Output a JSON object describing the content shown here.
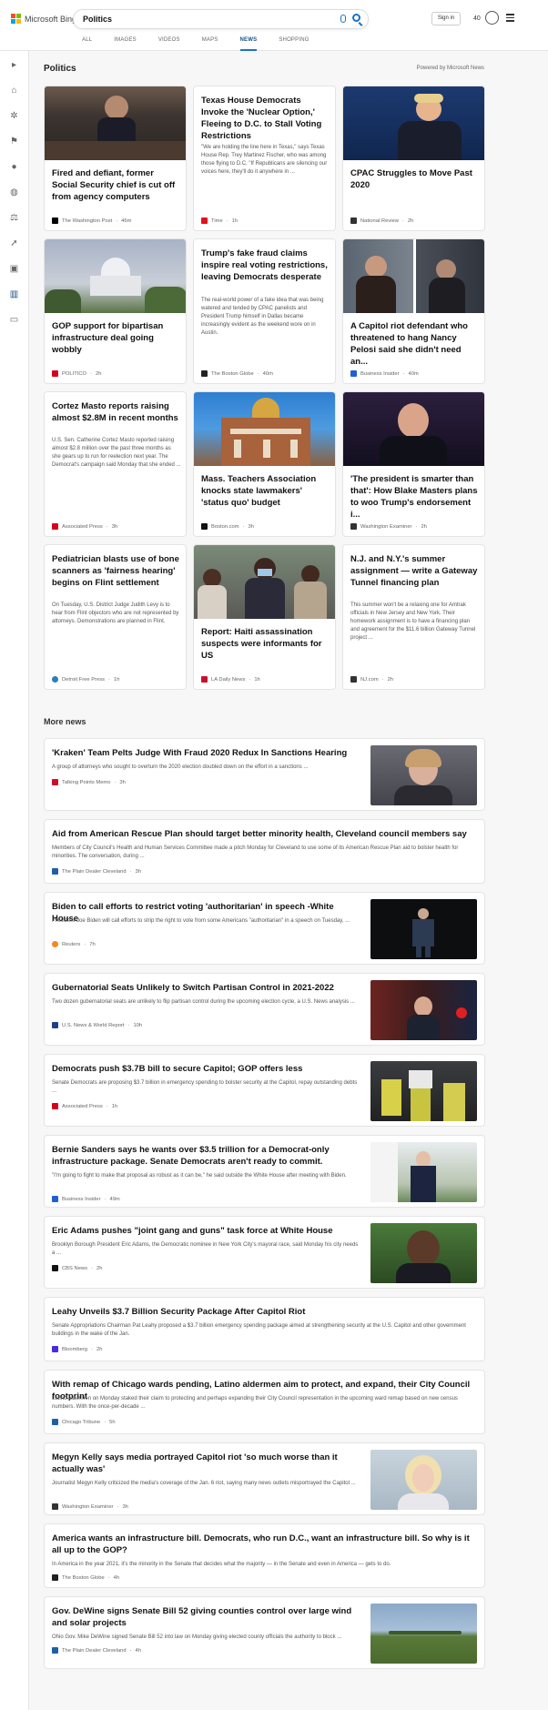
{
  "header": {
    "logo_text": "Microsoft Bing",
    "search_query": "Politics",
    "tabs": [
      "ALL",
      "IMAGES",
      "VIDEOS",
      "MAPS",
      "NEWS",
      "SHOPPING"
    ],
    "active_tab": "NEWS",
    "sign_in": "Sign in",
    "points": "40"
  },
  "section": {
    "title": "Politics",
    "powered_by": "Powered by Microsoft News"
  },
  "cards": [
    {
      "title": "Fired and defiant, former Social Security chief is cut off from agency computers",
      "desc": "",
      "source": "The Washington Post",
      "time": "46m",
      "logo_color": "#000000"
    },
    {
      "title": "Texas House Democrats Invoke the 'Nuclear Option,' Fleeing to D.C. to Stall Voting Restrictions",
      "desc": "\"We are holding the line here in Texas,\" says Texas House Rep. Trey Martinez Fischer, who was among those flying to D.C. \"If Republicans are silencing our voices here, they'll do it anywhere in ...",
      "source": "Time",
      "time": "1h",
      "logo_color": "#e4111c"
    },
    {
      "title": "CPAC Struggles to Move Past 2020",
      "desc": "",
      "source": "National Review",
      "time": "2h",
      "logo_color": "#333333"
    },
    {
      "title": "GOP support for bipartisan infrastructure deal going wobbly",
      "desc": "",
      "source": "POLITICO",
      "time": "2h",
      "logo_color": "#d6001c"
    },
    {
      "title": "Trump's fake fraud claims inspire real voting restrictions, leaving Democrats desperate",
      "desc": "The real-world power of a fake idea that was being watered and tended by CPAC panelists and President Trump himself in Dallas became increasingly evident as the weekend wore on in Austin.",
      "source": "The Boston Globe",
      "time": "40m",
      "logo_color": "#222222"
    },
    {
      "title": "A Capitol riot defendant who threatened to hang Nancy Pelosi said she didn't need an...",
      "desc": "",
      "source": "Business Insider",
      "time": "40m",
      "logo_color": "#1f5fd6"
    },
    {
      "title": "Cortez Masto reports raising almost $2.8M in recent months",
      "desc": "U.S. Sen. Catherine Cortez Masto reported raising almost $2.8 million over the past three months as she gears up to run for reelection next year. The Democrat's campaign said Monday that she ended ...",
      "source": "Associated Press",
      "time": "3h",
      "logo_color": "#d6001c"
    },
    {
      "title": "Mass. Teachers Association knocks state lawmakers' 'status quo' budget",
      "desc": "",
      "source": "Boston.com",
      "time": "3h",
      "logo_color": "#111111"
    },
    {
      "title": "'The president is smarter than that': How Blake Masters plans to woo Trump's endorsement i...",
      "desc": "",
      "source": "Washington Examiner",
      "time": "2h",
      "logo_color": "#333333"
    },
    {
      "title": "Pediatrician blasts use of bone scanners as 'fairness hearing' begins on Flint settlement",
      "desc": "On Tuesday, U.S. District Judge Judith Levy is to hear from Flint objectors who are not represented by attorneys. Demonstrations are planned in Flint.",
      "source": "Detroit Free Press",
      "time": "1h",
      "logo_color": "#2a7fb8"
    },
    {
      "title": "Report: Haiti assassination suspects were informants for US",
      "desc": "",
      "source": "LA Daily News",
      "time": "1h",
      "logo_color": "#c8102e"
    },
    {
      "title": "N.J. and N.Y.'s summer assignment — write a Gateway Tunnel financing plan",
      "desc": "This summer won't be a relaxing one for Amtrak officials in New Jersey and New York. Their homework assignment is to have a financing plan and agreement for the $11.6 billion Gateway Tunnel project ...",
      "source": "NJ.com",
      "time": "2h",
      "logo_color": "#333333"
    }
  ],
  "more_news": {
    "title": "More news",
    "items": [
      {
        "title": "'Kraken' Team Pelts Judge With Fraud 2020 Redux In Sanctions Hearing",
        "desc": "A group of attorneys who sought to overturn the 2020 election doubled down on the effort in a sanctions ...",
        "source": "Talking Points Memo",
        "time": "3h",
        "logo_color": "#c8102e"
      },
      {
        "title": "Aid from American Rescue Plan should target better minority health, Cleveland council members say",
        "desc": "Members of City Council's Health and Human Services Committee made a pitch Monday for Cleveland to use some of its American Rescue Plan aid to bolster health for minorities. The conversation, during ...",
        "source": "The Plain Dealer Cleveland",
        "time": "3h",
        "logo_color": "#1f5fa6"
      },
      {
        "title": "Biden to call efforts to restrict voting 'authoritarian' in speech -White House",
        "desc": "President Joe Biden will call efforts to strip the right to vote from some Americans \"authoritarian\" in a speech on Tuesday, ...",
        "source": "Reuters",
        "time": "7h",
        "logo_color": "#f08a24"
      },
      {
        "title": "Gubernatorial Seats Unlikely to Switch Partisan Control in 2021-2022",
        "desc": "Two dozen gubernatorial seats are unlikely to flip partisan control during the upcoming election cycle, a U.S. News analysis ...",
        "source": "U.S. News & World Report",
        "time": "10h",
        "logo_color": "#1f3f8a"
      },
      {
        "title": "Democrats push $3.7B bill to secure Capitol; GOP offers less",
        "desc": "Senate Democrats are proposing $3.7 billion in emergency spending to bolster security at the Capitol, repay outstanding debts ...",
        "source": "Associated Press",
        "time": "1h",
        "logo_color": "#d6001c"
      },
      {
        "title": "Bernie Sanders says he wants over $3.5 trillion for a Democrat-only infrastructure package. Senate Democrats aren't ready to commit.",
        "desc": "\"I'm going to fight to make that proposal as robust as it can be,\" he said outside the White House after meeting with Biden.",
        "source": "Business Insider",
        "time": "49m",
        "logo_color": "#1f5fd6"
      },
      {
        "title": "Eric Adams pushes \"joint gang and guns\" task force at White House",
        "desc": "Brooklyn Borough President Eric Adams, the Democratic nominee in New York City's mayoral race, said Monday his city needs a ...",
        "source": "CBS News",
        "time": "2h",
        "logo_color": "#111111"
      },
      {
        "title": "Leahy Unveils $3.7 Billion Security Package After Capitol Riot",
        "desc": "Senate Appropriations Chairman Pat Leahy proposed a $3.7 billion emergency spending package aimed at strengthening security at the U.S. Capitol and other government buildings in the wake of the Jan.",
        "source": "Bloomberg",
        "time": "2h",
        "logo_color": "#4b2bd6"
      },
      {
        "title": "With remap of Chicago wards pending, Latino aldermen aim to protect, and expand, their City Council footprint",
        "desc": "Latino aldermen on Monday staked their claim to protecting and perhaps expanding their City Council representation in the upcoming ward remap based on new census numbers. With the once-per-decade ...",
        "source": "Chicago Tribune",
        "time": "5h",
        "logo_color": "#1f5fa6"
      },
      {
        "title": "Megyn Kelly says media portrayed Capitol riot 'so much worse than it actually was'",
        "desc": "Journalist Megyn Kelly criticized the media's coverage of the Jan. 6 riot, saying many news outlets misportrayed the Capitol ...",
        "source": "Washington Examiner",
        "time": "3h",
        "logo_color": "#333333"
      },
      {
        "title": "America wants an infrastructure bill. Democrats, who run D.C., want an infrastructure bill. So why is it all up to the GOP?",
        "desc": "In America in the year 2021, it's the minority in the Senate that decides what the majority — in the Senate and even in America — gets to do.",
        "source": "The Boston Globe",
        "time": "4h",
        "logo_color": "#222222"
      },
      {
        "title": "Gov. DeWine signs Senate Bill 52 giving counties control over large wind and solar projects",
        "desc": "Ohio Gov. Mike DeWine signed Senate Bill 52 into law on Monday giving elected county officials the authority to block ...",
        "source": "The Plain Dealer Cleveland",
        "time": "4h",
        "logo_color": "#1f5fa6"
      }
    ]
  }
}
